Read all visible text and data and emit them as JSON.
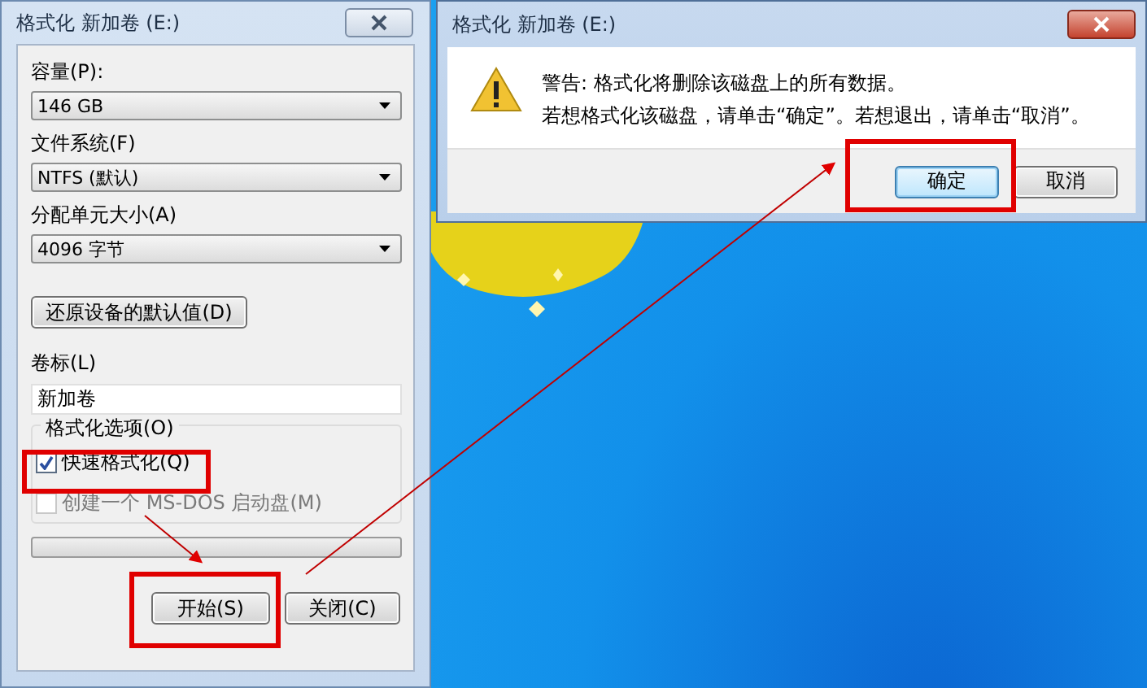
{
  "format_window": {
    "title": "格式化 新加卷 (E:)",
    "fields": [
      {
        "label": "容量(P):",
        "value": "146 GB"
      },
      {
        "label": "文件系统(F)",
        "value": "NTFS (默认)"
      },
      {
        "label": "分配单元大小(A)",
        "value": "4096 字节"
      }
    ],
    "restore_button": "还原设备的默认值(D)",
    "volume_label": {
      "label": "卷标(L)",
      "value": "新加卷"
    },
    "options": {
      "legend": "格式化选项(O)",
      "checkboxes": [
        {
          "label": "快速格式化(Q)",
          "checked": true,
          "disabled": false
        },
        {
          "label": "创建一个 MS-DOS 启动盘(M)",
          "checked": false,
          "disabled": true
        }
      ]
    },
    "progress": {
      "level": 0
    },
    "buttons": [
      {
        "label": "开始(S)"
      },
      {
        "label": "关闭(C)"
      }
    ]
  },
  "confirm_dialog": {
    "title": "格式化 新加卷 (E:)",
    "message": [
      "警告: 格式化将删除该磁盘上的所有数据。",
      "若想格式化该磁盘，请单击“确定”。若想退出，请单击“取消”。"
    ],
    "buttons": [
      {
        "label": "确定",
        "selected": true
      },
      {
        "label": "取消",
        "selected": false
      }
    ]
  }
}
